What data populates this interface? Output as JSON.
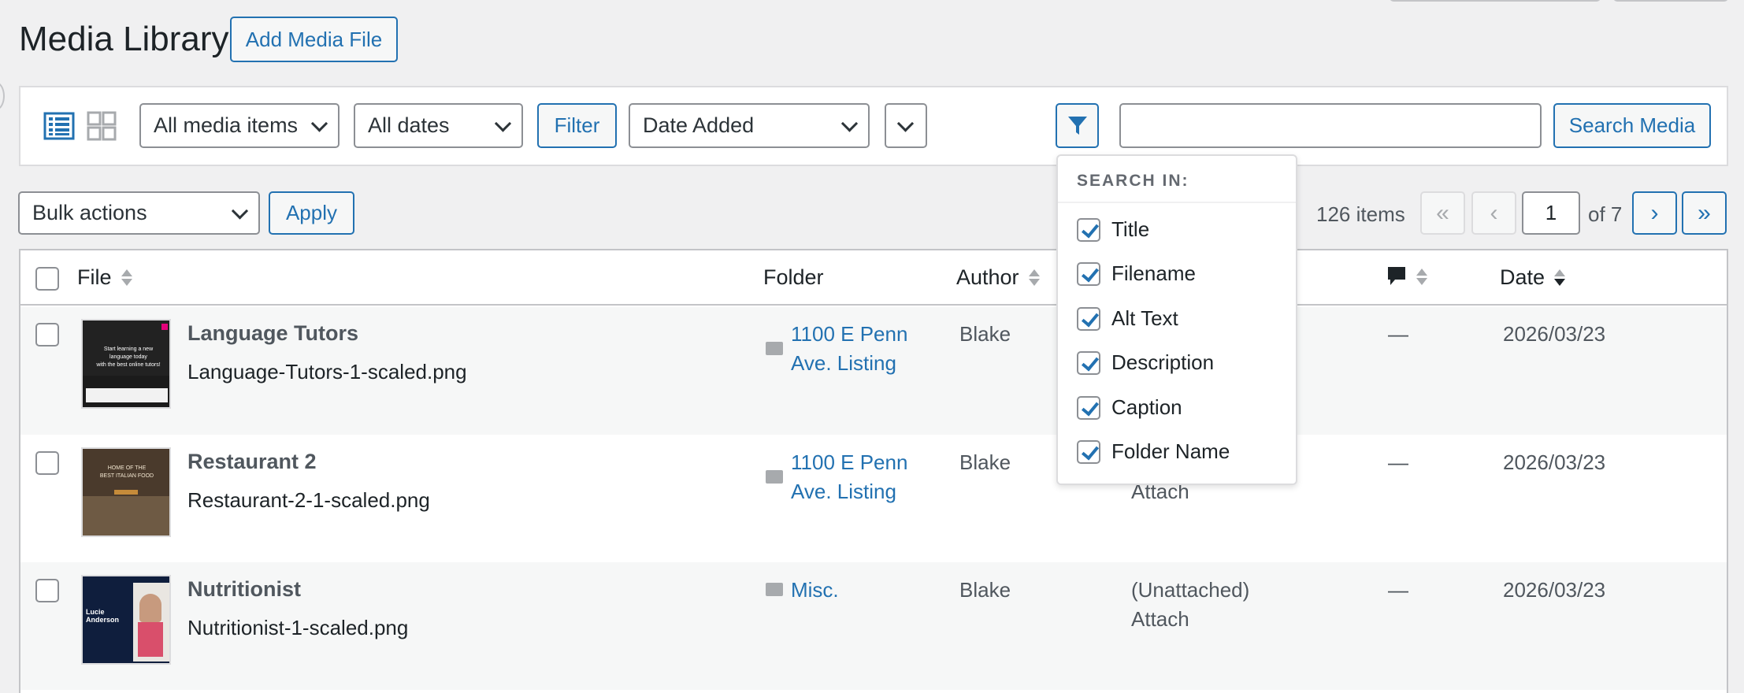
{
  "header": {
    "title": "Media Library",
    "add_button": "Add Media File"
  },
  "toolbar": {
    "media_type": "All media items",
    "dates": "All dates",
    "filter_button": "Filter",
    "sort_by": "Date Added",
    "search_button": "Search Media",
    "search_value": ""
  },
  "search_in": {
    "title": "SEARCH IN:",
    "options": [
      {
        "label": "Title",
        "checked": true
      },
      {
        "label": "Filename",
        "checked": true
      },
      {
        "label": "Alt Text",
        "checked": true
      },
      {
        "label": "Description",
        "checked": true
      },
      {
        "label": "Caption",
        "checked": true
      },
      {
        "label": "Folder Name",
        "checked": true
      }
    ]
  },
  "bulk": {
    "actions": "Bulk actions",
    "apply": "Apply"
  },
  "pagination": {
    "count": "126 items",
    "first": "«",
    "prev": "‹",
    "current": "1",
    "of": "of 7",
    "next": "›",
    "last": "»"
  },
  "columns": {
    "file": "File",
    "folder": "Folder",
    "author": "Author",
    "date": "Date"
  },
  "rows": [
    {
      "title": "Language Tutors",
      "filename": "Language-Tutors-1-scaled.png",
      "folder_line1": "1100 E Penn",
      "folder_line2": "Ave. Listing",
      "author": "Blake",
      "uploaded_line1": "",
      "uploaded_line2": "",
      "comments": "—",
      "date": "2026/03/23"
    },
    {
      "title": "Restaurant 2",
      "filename": "Restaurant-2-1-scaled.png",
      "folder_line1": "1100 E Penn",
      "folder_line2": "Ave. Listing",
      "author": "Blake",
      "uploaded_line1": "",
      "uploaded_line2": "Attach",
      "comments": "—",
      "date": "2026/03/23"
    },
    {
      "title": "Nutritionist",
      "filename": "Nutritionist-1-scaled.png",
      "folder_line1": "Misc.",
      "folder_line2": "",
      "author": "Blake",
      "uploaded_line1": "(Unattached)",
      "uploaded_line2": "Attach",
      "comments": "—",
      "date": "2026/03/23"
    }
  ],
  "thumbs": {
    "t1_line1": "Start learning a new",
    "t1_line2": "language today",
    "t1_line3": "with the best online tutors!",
    "t2_line1": "HOME OF THE",
    "t2_line2": "BEST ITALIAN FOOD",
    "t3_name": "Lucie Anderson"
  },
  "colors": {
    "accent": "#2271b1",
    "background": "#f0f0f1"
  }
}
